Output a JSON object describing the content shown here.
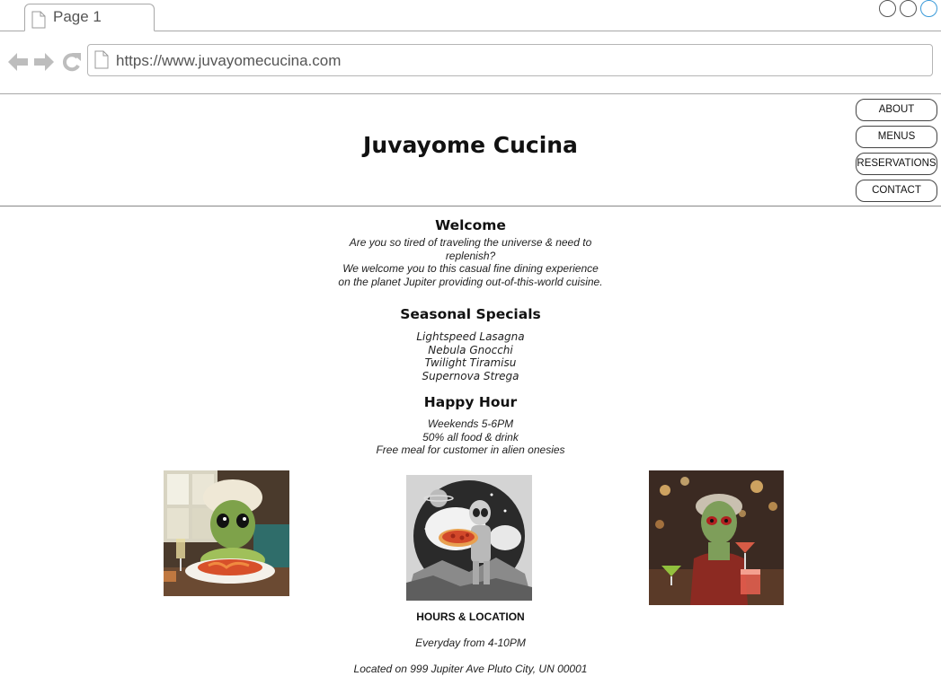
{
  "browser": {
    "tab_title": "Page 1",
    "url": "https://www.juvayomecucina.com"
  },
  "site": {
    "title": "Juvayome Cucina",
    "nav": [
      "ABOUT",
      "MENUS",
      "RESERVATIONS",
      "CONTACT"
    ]
  },
  "welcome": {
    "heading": "Welcome",
    "line1": "Are you so tired of traveling the universe & need to replenish?",
    "line2": "We welcome you to this casual fine dining experience on the planet Jupiter providing out-of-this-world cuisine."
  },
  "specials": {
    "heading": "Seasonal Specials",
    "items": [
      "Lightspeed Lasagna",
      "Nebula Gnocchi",
      "Twilight Tiramisu",
      "Supernova Strega"
    ]
  },
  "happy_hour": {
    "heading": "Happy Hour",
    "lines": [
      "Weekends 5-6PM",
      "50% all food & drink",
      "Free meal for customer in alien onesies"
    ]
  },
  "images": [
    {
      "icon": "alien-chef-eating-spaghetti-image"
    },
    {
      "icon": "astronaut-alien-holding-pizza-image"
    },
    {
      "icon": "alien-waitress-with-cocktails-image"
    }
  ],
  "footer": {
    "heading": "HOURS & LOCATION",
    "hours": "Everyday from 4-10PM",
    "location": "Located on 999 Jupiter Ave Pluto City, UN 00001"
  }
}
